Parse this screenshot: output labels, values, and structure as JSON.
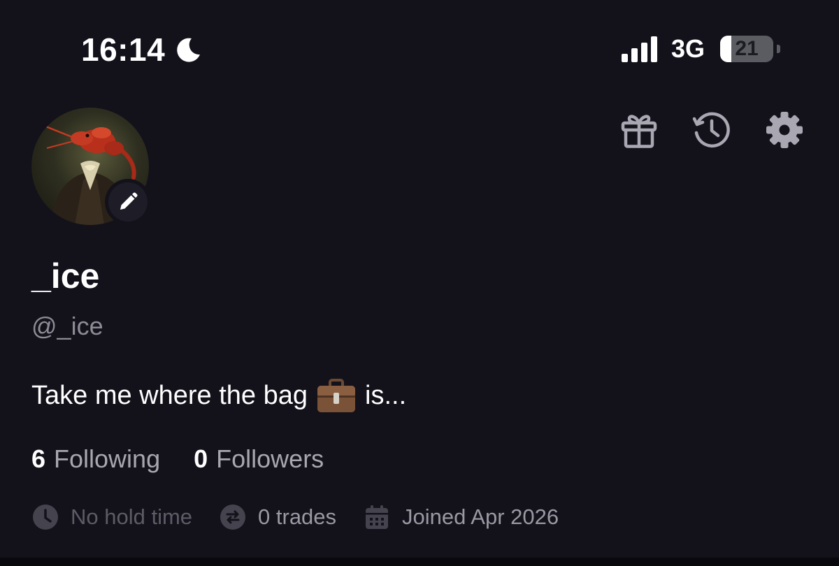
{
  "status_bar": {
    "time": "16:14",
    "network": "3G",
    "battery_level": "21",
    "battery_fraction": 0.21,
    "signal_bars": 4
  },
  "header": {
    "icons": [
      "gift-icon",
      "history-icon",
      "settings-gear-icon"
    ]
  },
  "profile": {
    "display_name": "_ice",
    "handle": "@_ice",
    "bio_before": "Take me where the bag",
    "bio_emoji": "briefcase",
    "bio_after": "is...",
    "following_count": "6",
    "following_label": "Following",
    "followers_count": "0",
    "followers_label": "Followers",
    "hold_time": "No hold time",
    "trades": "0 trades",
    "joined": "Joined Apr 2026"
  },
  "colors": {
    "background": "#13121b",
    "text_primary": "#ffffff",
    "text_secondary": "#8d8c96",
    "text_muted": "#5d5c66",
    "icon": "#a9a8b2"
  }
}
